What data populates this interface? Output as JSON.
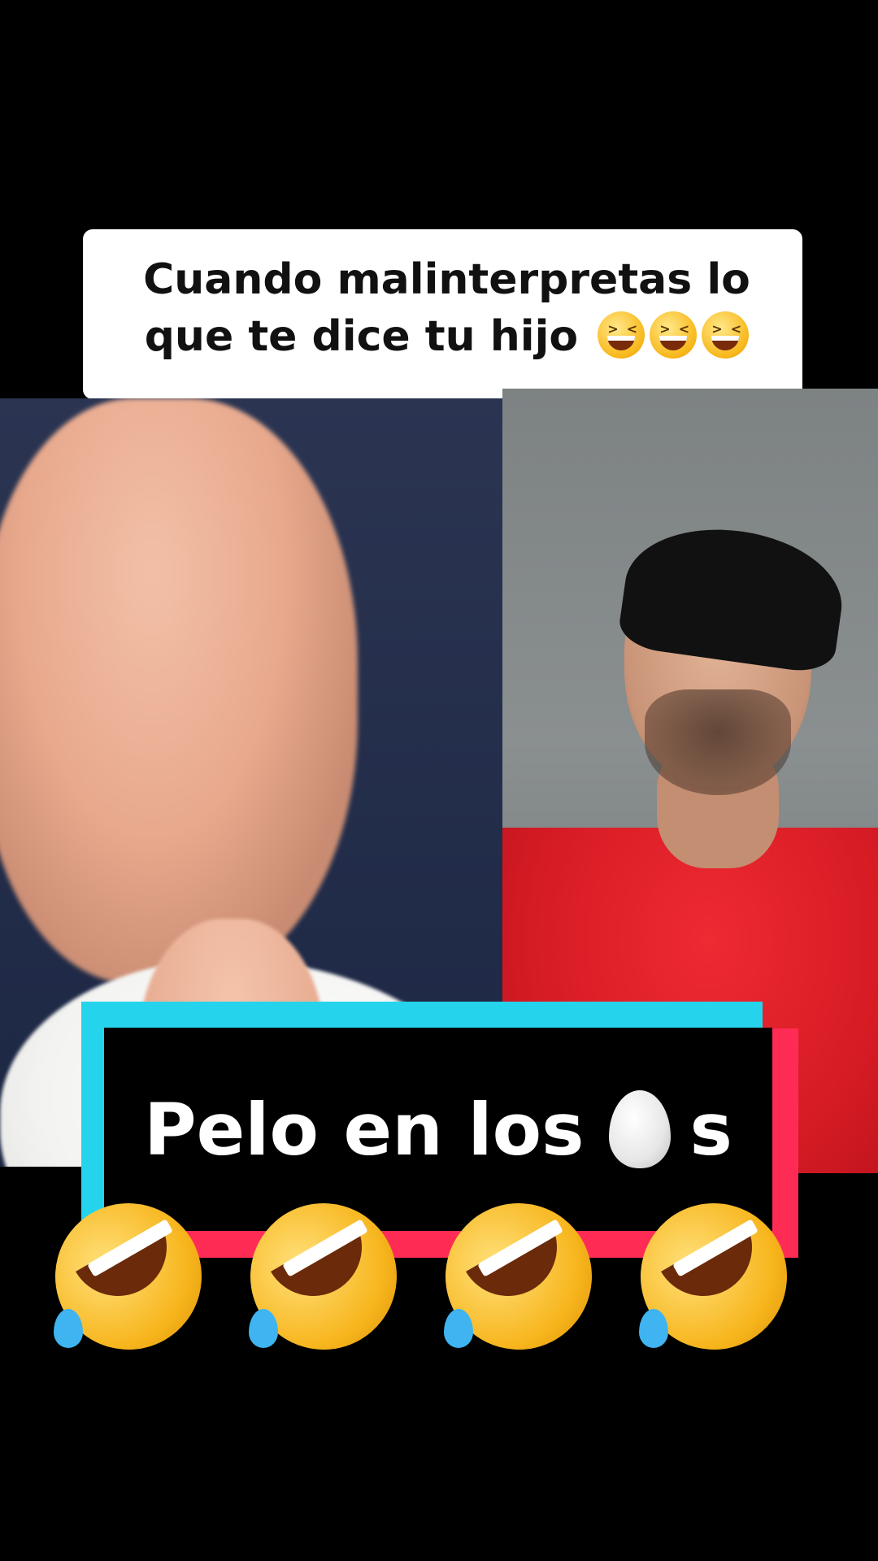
{
  "caption": {
    "line1": "Cuando malinterpretas lo",
    "line2": "que te dice tu hijo",
    "emoji_icons": [
      "grinning-squinting-face-icon",
      "grinning-squinting-face-icon",
      "grinning-squinting-face-icon"
    ]
  },
  "title": {
    "prefix": "Pelo en los",
    "suffix": "s",
    "icon": "egg-icon"
  },
  "emoji_row": {
    "icons": [
      "rolling-on-floor-laughing-icon",
      "rolling-on-floor-laughing-icon",
      "rolling-on-floor-laughing-icon",
      "rolling-on-floor-laughing-icon"
    ]
  },
  "colors": {
    "background": "#000000",
    "accent_cyan": "#25d4ec",
    "accent_red": "#fe2c55",
    "caption_bg": "#ffffff"
  }
}
